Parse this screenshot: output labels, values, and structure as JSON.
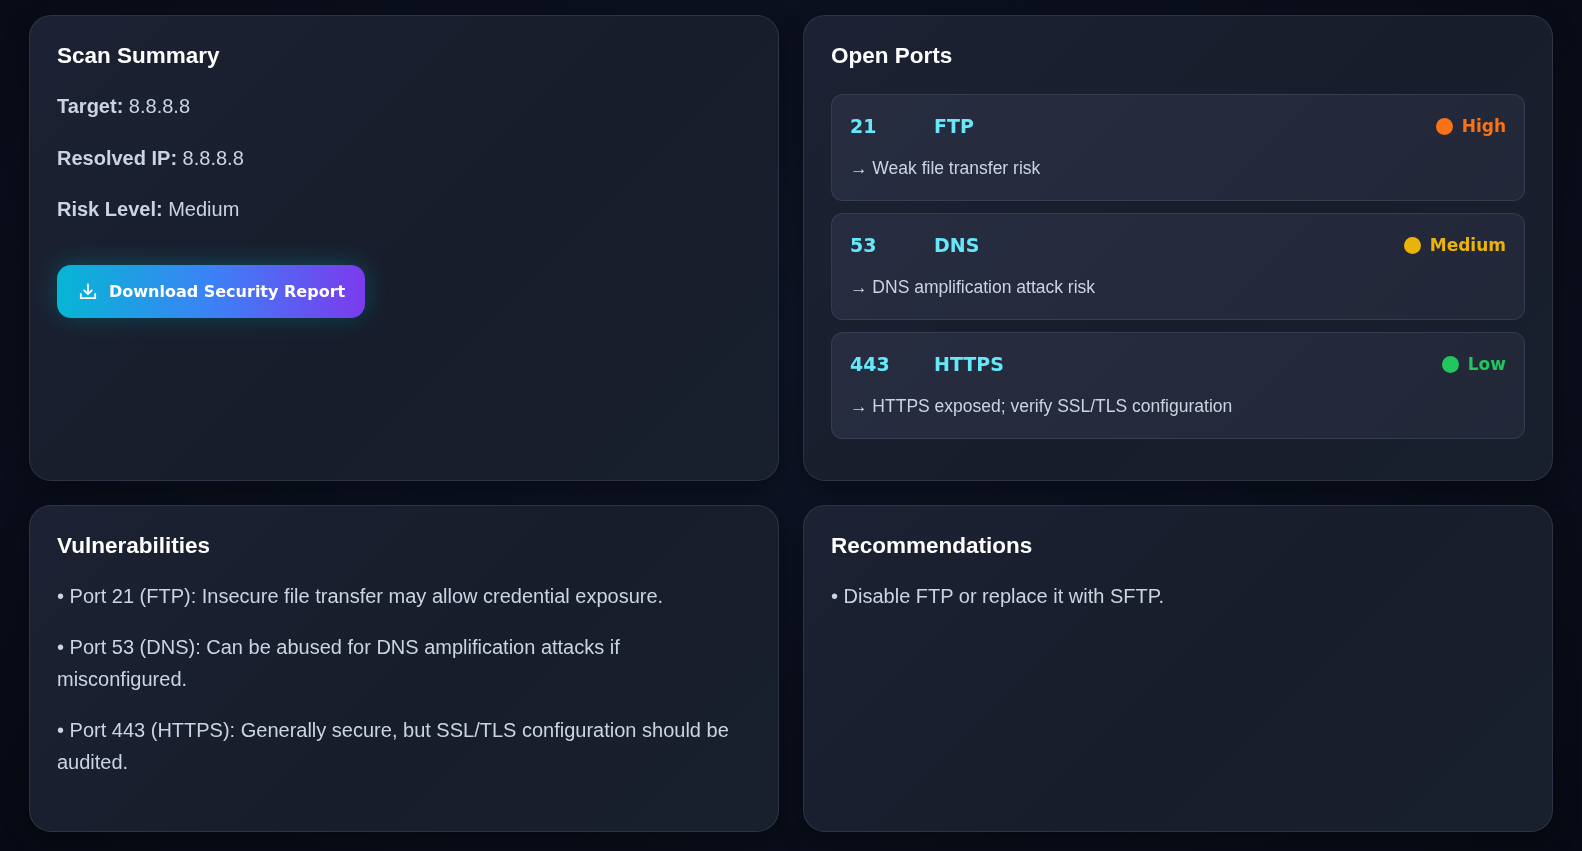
{
  "scan_summary": {
    "title": "Scan Summary",
    "fields": [
      "**Target:** 8.8.8.8",
      "**Resolved IP:** 8.8.8.8",
      "**Risk Level:** Medium"
    ],
    "button": "Download Security Report"
  },
  "open_ports": {
    "title": "Open Ports",
    "ports": [
      {
        "port": "21",
        "service": "FTP",
        "risk": "High",
        "color": "#f97316",
        "description": "→ Weak file transfer risk"
      },
      {
        "port": "53",
        "service": "DNS",
        "risk": "Medium",
        "color": "#eab308",
        "description": "→ DNS amplification attack risk"
      },
      {
        "port": "443",
        "service": "HTTPS",
        "risk": "Low",
        "color": "#22c55e",
        "description": "→ HTTPS exposed; verify SSL/TLS configuration"
      }
    ]
  },
  "vulnerabilities": {
    "title": "Vulnerabilities",
    "items": [
      "• Port 21 (FTP): Insecure file transfer may allow credential exposure.",
      "• Port 53 (DNS): Can be abused for DNS amplification attacks if misconfigured.",
      "• Port 443 (HTTPS): Generally secure, but SSL/TLS configuration should be audited."
    ]
  },
  "recommendations": {
    "title": "Recommendations",
    "items": [
      "• Disable FTP or replace it with SFTP."
    ]
  }
}
